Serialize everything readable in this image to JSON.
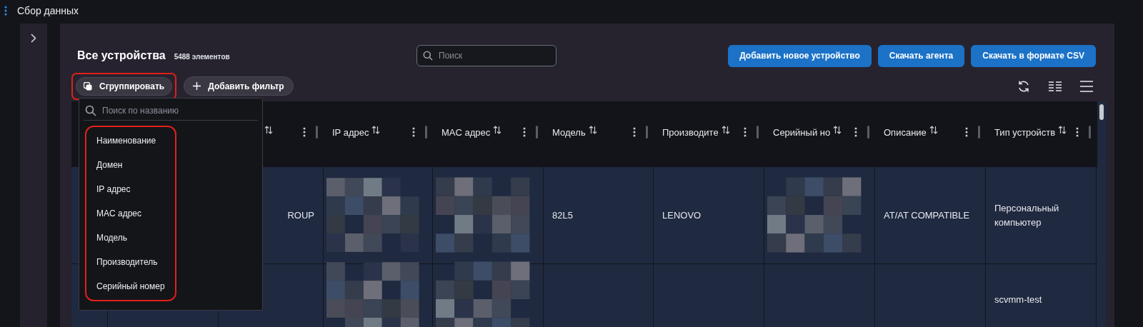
{
  "app_bar": {
    "title": "Сбор данных"
  },
  "page": {
    "title": "Все устройства",
    "count": "5488 элементов",
    "search": {
      "placeholder": "Поиск"
    },
    "actions": [
      "Добавить новое устройство",
      "Скачать агента",
      "Скачать в формате CSV"
    ],
    "group_button": {
      "label": "Сгруппировать",
      "highlighted": true
    },
    "filter_button": {
      "label": "Добавить фильтр"
    }
  },
  "group_menu": {
    "search": {
      "placeholder": "Поиск по названию"
    },
    "highlighted": true,
    "items": [
      "Наименование",
      "Домен",
      "IP адрес",
      "MAC адрес",
      "Модель",
      "Производитель",
      "Серийный номер"
    ]
  },
  "table": {
    "columns": [
      {
        "kind": "plain"
      },
      {
        "kind": "plain"
      },
      {
        "kind": "sortable"
      },
      {
        "kind": "sortable",
        "label": "IP адрес"
      },
      {
        "kind": "sortable",
        "label": "MAC адрес"
      },
      {
        "kind": "sortable",
        "label": "Модель"
      },
      {
        "kind": "sortable",
        "label": "Производите"
      },
      {
        "kind": "sortable",
        "label": "Серийный но"
      },
      {
        "kind": "sortable",
        "label": "Описание"
      },
      {
        "kind": "sortable",
        "label": "Тип устройств"
      }
    ],
    "rows": [
      {
        "cells": [
          {},
          {},
          {
            "text": "ROUP"
          },
          {
            "redacted": true
          },
          {
            "redacted": true
          },
          {
            "text": "82L5"
          },
          {
            "text": "LENOVO"
          },
          {
            "redacted": true
          },
          {
            "text": "AT/AT COMPATIBLE"
          },
          {
            "text": "Персональный компьютер"
          }
        ]
      },
      {
        "cells": [
          {},
          {},
          {},
          {
            "redacted": true
          },
          {
            "redacted": true
          },
          {},
          {},
          {},
          {},
          {
            "text": "scvmm-test"
          }
        ]
      }
    ]
  }
}
